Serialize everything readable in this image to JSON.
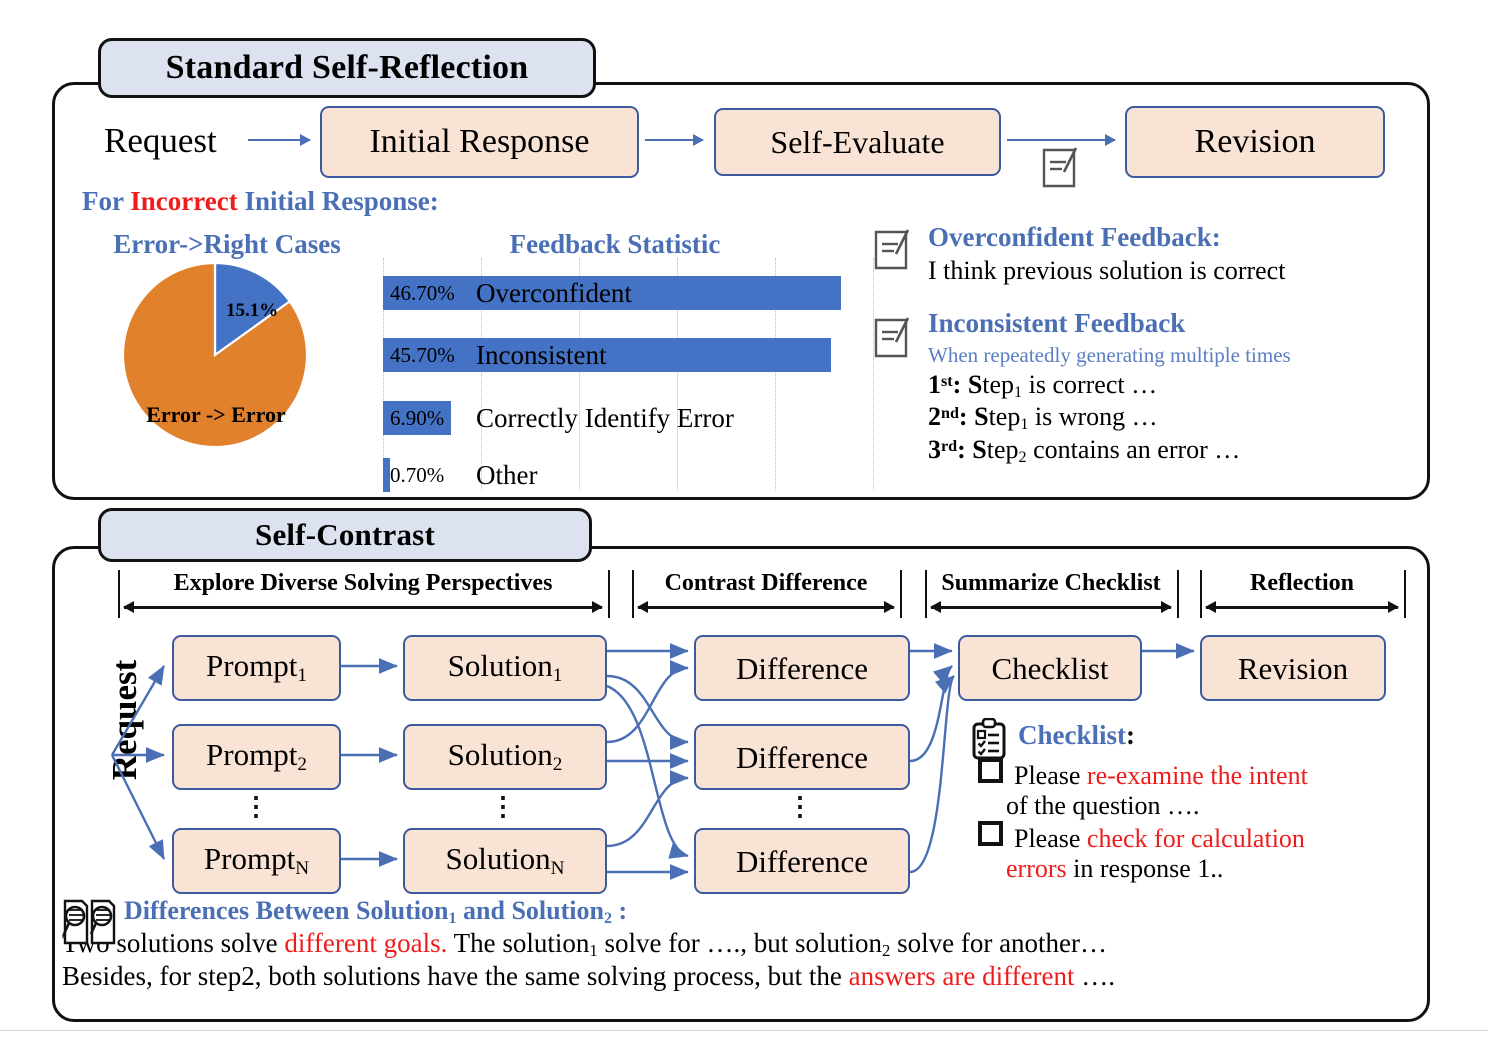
{
  "panels": {
    "reflection": {
      "title": "Standard Self-Reflection",
      "request_label": "Request",
      "flow": [
        {
          "id": "initial-response",
          "label": "Initial Response"
        },
        {
          "id": "self-evaluate",
          "label": "Self-Evaluate"
        },
        {
          "id": "revision",
          "label": "Revision"
        }
      ],
      "condition_prefix": "For ",
      "condition_highlight": "Incorrect",
      "condition_suffix": " Initial Response:",
      "pie_heading": "Error->Right Cases",
      "bar_heading": "Feedback Statistic"
    },
    "contrast": {
      "title": "Self-Contrast",
      "request_label": "Request",
      "stages": [
        {
          "id": "explore",
          "label": "Explore Diverse Solving Perspectives"
        },
        {
          "id": "contrast",
          "label": "Contrast Difference"
        },
        {
          "id": "summarize",
          "label": "Summarize Checklist"
        },
        {
          "id": "reflection",
          "label": "Reflection"
        }
      ],
      "prompts": [
        "Prompt",
        "Prompt",
        "Prompt"
      ],
      "prompt_subs": [
        "1",
        "2",
        "N"
      ],
      "solutions": [
        "Solution",
        "Solution",
        "Solution"
      ],
      "solution_subs": [
        "1",
        "2",
        "N"
      ],
      "differences": [
        "Difference",
        "Difference",
        "Difference"
      ],
      "checklist_box": "Checklist",
      "revision_box": "Revision",
      "ellipsis": "⋮"
    }
  },
  "chart_data": [
    {
      "type": "pie",
      "title": "Error->Right Cases",
      "labels": [
        "Error -> Right",
        "Error -> Error"
      ],
      "values": [
        15.1,
        84.9
      ],
      "colors": [
        "#4472c4",
        "#e1812c"
      ],
      "data_labels": [
        "15.1%",
        "Error -> Error"
      ],
      "start_angle_deg": 0,
      "legend": "none"
    },
    {
      "type": "bar",
      "orientation": "horizontal",
      "title": "Feedback Statistic",
      "categories": [
        "Overconfident",
        "Inconsistent",
        "Correctly Identify Error",
        "Other"
      ],
      "values": [
        46.7,
        45.7,
        6.9,
        0.7
      ],
      "value_labels": [
        "46.70%",
        "45.70%",
        "6.90%",
        "0.70%"
      ],
      "xlim": [
        0,
        50
      ],
      "gridlines": [
        0,
        10,
        20,
        30,
        40,
        50
      ],
      "grid": true,
      "bar_color": "#4472c4",
      "xlabel": "",
      "ylabel": "",
      "legend": "none"
    }
  ],
  "feedback": {
    "overconfident": {
      "icon": "note-edit-icon",
      "heading": "Overconfident Feedback:",
      "body": "I think previous solution is correct"
    },
    "inconsistent": {
      "icon": "note-edit-icon",
      "heading": "Inconsistent Feedback",
      "subtitle": "When repeatedly generating multiple times",
      "items": [
        {
          "ord": "1",
          "sup": "st",
          "punct": ":",
          "text_pre": "S",
          "text_mid": "tep",
          "sub": "1",
          "text_post": " is correct …"
        },
        {
          "ord": "2",
          "sup": "nd",
          "punct": ":",
          "text_pre": "S",
          "text_mid": "tep",
          "sub": "1",
          "text_post": " is wrong …"
        },
        {
          "ord": "3",
          "sup": "rd",
          "punct": ":",
          "text_pre": "S",
          "text_mid": "tep",
          "sub": "2",
          "text_post": " contains an error …"
        }
      ]
    }
  },
  "checklist": {
    "icon": "clipboard-checklist-icon",
    "title": "Checklist",
    "title_colon": ":",
    "items": [
      {
        "pre": "Please ",
        "red": "re-examine the intent",
        "post": "",
        "second_line_pre": "of the question ….",
        "second_line_red": ""
      },
      {
        "pre": "Please ",
        "red": "check for calculation",
        "post": "",
        "second_line_pre": "",
        "second_line_red": "errors",
        "second_line_post": " in response 1.."
      }
    ]
  },
  "differences": {
    "icon": "documents-magnifier-icon",
    "title_pre": "Differences Between Solution",
    "title_sub1": "1",
    "title_mid": " and Solution",
    "title_sub2": "2",
    "title_post": " :",
    "line1_a": "Two solutions solve ",
    "line1_red": "different goals.",
    "line1_b": " The solution",
    "line1_sub1": "1",
    "line1_c": " solve for …., but solution",
    "line1_sub2": "2",
    "line1_d": " solve for another…",
    "line2_a": "Besides, for step2, both solutions have the same solving process, but the ",
    "line2_red": "answers are different",
    "line2_b": " …."
  },
  "colors": {
    "accent_blue": "#4a6fb5",
    "bar_blue": "#4472c4",
    "pie_orange": "#e1812c",
    "box_fill": "#f8e3d4",
    "box_border": "#3d5a9e",
    "badge_fill": "#dde2f0",
    "red": "#ef1c1c"
  }
}
